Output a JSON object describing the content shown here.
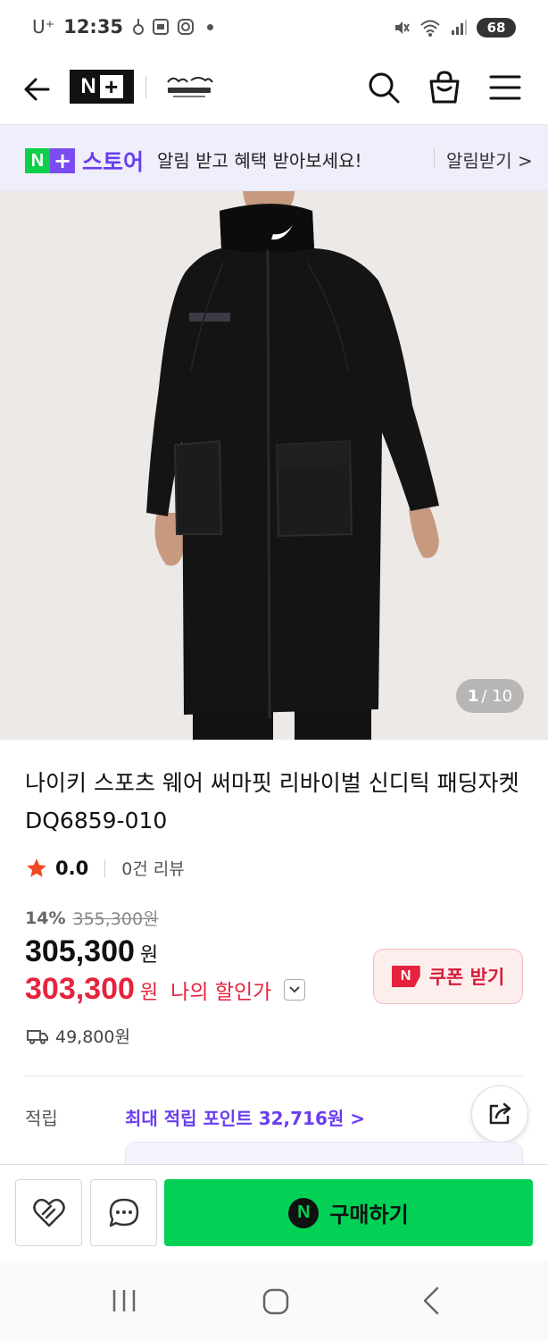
{
  "status_bar": {
    "carrier": "U⁺",
    "time": "12:35",
    "battery": "68"
  },
  "header": {
    "logo_text": "N",
    "brand_logo_alt": "재변마루"
  },
  "notification_banner": {
    "store_label": "스토어",
    "message": "알림 받고 혜택 받아보세요!",
    "action": "알림받기 >"
  },
  "gallery": {
    "current": "1",
    "total": "/ 10"
  },
  "product": {
    "title": "나이키 스포츠 웨어 써마핏 리바이벌 신디틱 패딩자켓 DQ6859-010",
    "rating": "0.0",
    "review_count": "0건 리뷰",
    "discount_rate": "14%",
    "original_price": "355,300원",
    "price": "305,300",
    "price_unit": "원",
    "my_price": "303,300",
    "my_price_unit": "원",
    "my_price_label": "나의 할인가",
    "coupon_label": "쿠폰 받기",
    "shipping_fee": "49,800원"
  },
  "points": {
    "label": "적립",
    "value": "최대 적립 포인트 32,716원 >"
  },
  "bottom_bar": {
    "buy_label": "구매하기",
    "buy_icon_letter": "N"
  },
  "colors": {
    "naver_green": "#03d156",
    "nplus_purple": "#6b3df0",
    "sale_red": "#e5233e"
  }
}
